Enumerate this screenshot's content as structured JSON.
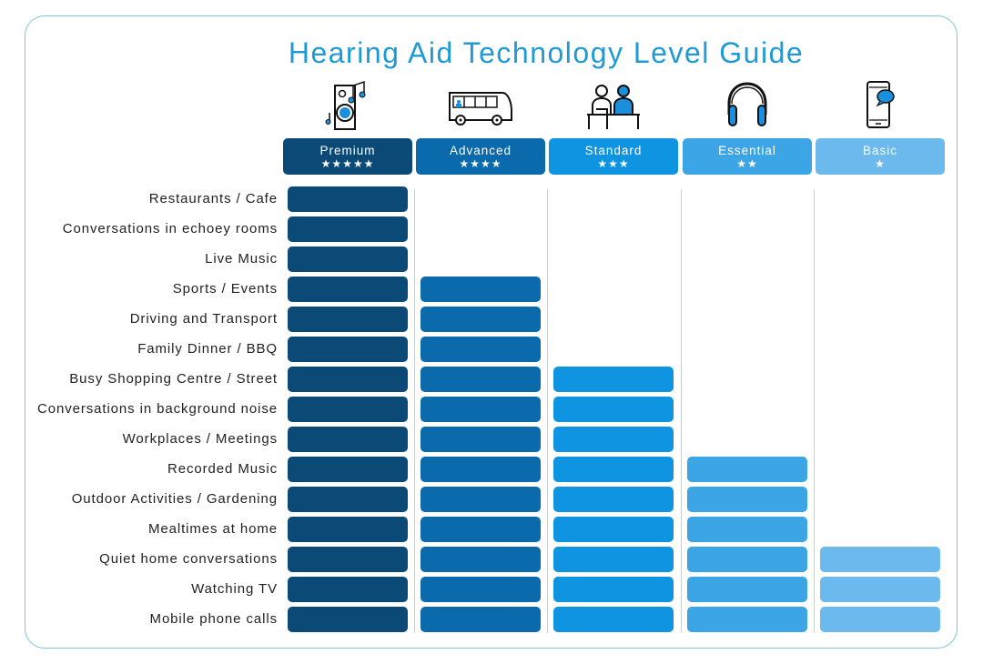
{
  "chart_data": {
    "type": "table",
    "title": "Hearing Aid Technology Level Guide",
    "columns": [
      {
        "label": "Premium",
        "stars": "★★★★★",
        "rating": 5,
        "color": "#0b4a77",
        "icon": "speaker-music-icon"
      },
      {
        "label": "Advanced",
        "stars": "★★★★",
        "rating": 4,
        "color": "#0b6aab",
        "icon": "bus-icon"
      },
      {
        "label": "Standard",
        "stars": "★★★",
        "rating": 3,
        "color": "#0e94e0",
        "icon": "two-people-meeting-icon"
      },
      {
        "label": "Essential",
        "stars": "★★",
        "rating": 2,
        "color": "#3ba5e5",
        "icon": "headphones-icon"
      },
      {
        "label": "Basic",
        "stars": "★",
        "rating": 1,
        "color": "#6cbaed",
        "icon": "mobile-phone-chat-icon"
      }
    ],
    "rows": [
      {
        "label": "Restaurants / Cafe",
        "levels_supported": 1
      },
      {
        "label": "Conversations in echoey rooms",
        "levels_supported": 1
      },
      {
        "label": "Live Music",
        "levels_supported": 1
      },
      {
        "label": "Sports / Events",
        "levels_supported": 2
      },
      {
        "label": "Driving and Transport",
        "levels_supported": 2
      },
      {
        "label": "Family Dinner / BBQ",
        "levels_supported": 2
      },
      {
        "label": "Busy Shopping Centre / Street",
        "levels_supported": 3
      },
      {
        "label": "Conversations in background noise",
        "levels_supported": 3
      },
      {
        "label": "Workplaces / Meetings",
        "levels_supported": 3
      },
      {
        "label": "Recorded Music",
        "levels_supported": 4
      },
      {
        "label": "Outdoor Activities / Gardening",
        "levels_supported": 4
      },
      {
        "label": "Mealtimes at home",
        "levels_supported": 4
      },
      {
        "label": "Quiet home conversations",
        "levels_supported": 5
      },
      {
        "label": "Watching TV",
        "levels_supported": 5
      },
      {
        "label": "Mobile phone calls",
        "levels_supported": 5
      }
    ],
    "title_color": "#1e9bd7"
  }
}
